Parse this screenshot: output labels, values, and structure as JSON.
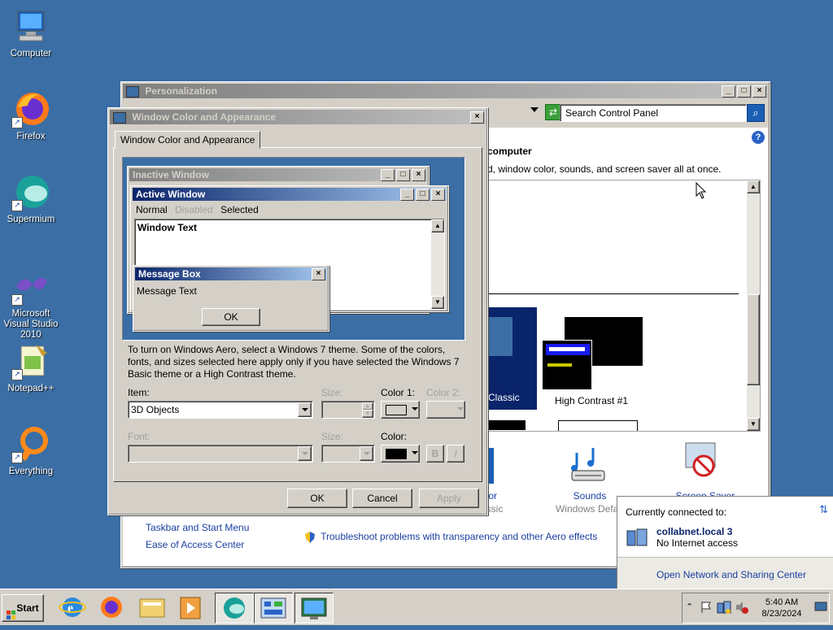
{
  "desktop": {
    "icons": [
      {
        "label": "Computer"
      },
      {
        "label": "Firefox"
      },
      {
        "label": "Supermium"
      },
      {
        "label": "Microsoft Visual Studio 2010"
      },
      {
        "label": "Notepad++"
      },
      {
        "label": "Everything"
      }
    ]
  },
  "personalization": {
    "title": "Personalization",
    "search_placeholder": "Search Control Panel",
    "heading": "computer",
    "description": "d, window color, sounds, and screen saver all at once.",
    "themes": [
      {
        "label": "Classic"
      },
      {
        "label": "High Contrast #1"
      }
    ],
    "settings": [
      {
        "label": "olor",
        "sub": "assic"
      },
      {
        "label": "Sounds",
        "sub": "Windows Defau"
      },
      {
        "label": "Screen Saver",
        "sub": ""
      }
    ],
    "links": [
      "Taskbar and Start Menu",
      "Ease of Access Center"
    ],
    "troubleshoot_link": "Troubleshoot problems with transparency and other Aero effects"
  },
  "wca": {
    "title": "Window Color and Appearance",
    "tab_label": "Window Color and Appearance",
    "preview": {
      "inactive_title": "Inactive Window",
      "active_title": "Active Window",
      "menu_normal": "Normal",
      "menu_disabled": "Disabled",
      "menu_selected": "Selected",
      "window_text": "Window Text",
      "msgbox_title": "Message Box",
      "msgbox_text": "Message Text",
      "msgbox_ok": "OK"
    },
    "info_text": "To turn on Windows Aero, select a Windows 7 theme.  Some of the colors, fonts, and sizes selected here apply only if you have selected the Windows 7 Basic theme or a High Contrast theme.",
    "item_label": "Item:",
    "item_value": "3D Objects",
    "size_label": "Size:",
    "color1_label": "Color 1:",
    "color2_label": "Color 2:",
    "font_label": "Font:",
    "font_size_label": "Size:",
    "font_color_label": "Color:",
    "bold_label": "B",
    "italic_label": "I",
    "buttons": {
      "ok": "OK",
      "cancel": "Cancel",
      "apply": "Apply"
    },
    "colors": {
      "color1": "#d4d0c8",
      "font_color": "#000000"
    }
  },
  "network": {
    "connected_to": "Currently connected to:",
    "network_name": "collabnet.local  3",
    "status": "No Internet access",
    "link": "Open Network and Sharing Center"
  },
  "taskbar": {
    "start_label": "Start",
    "apps": [
      "internet-explorer-icon",
      "firefox-icon",
      "explorer-icon",
      "media-player-icon",
      "supermium-icon",
      "control-panel-icon",
      "display-icon"
    ],
    "time": "5:40 AM",
    "date": "8/23/2024"
  }
}
